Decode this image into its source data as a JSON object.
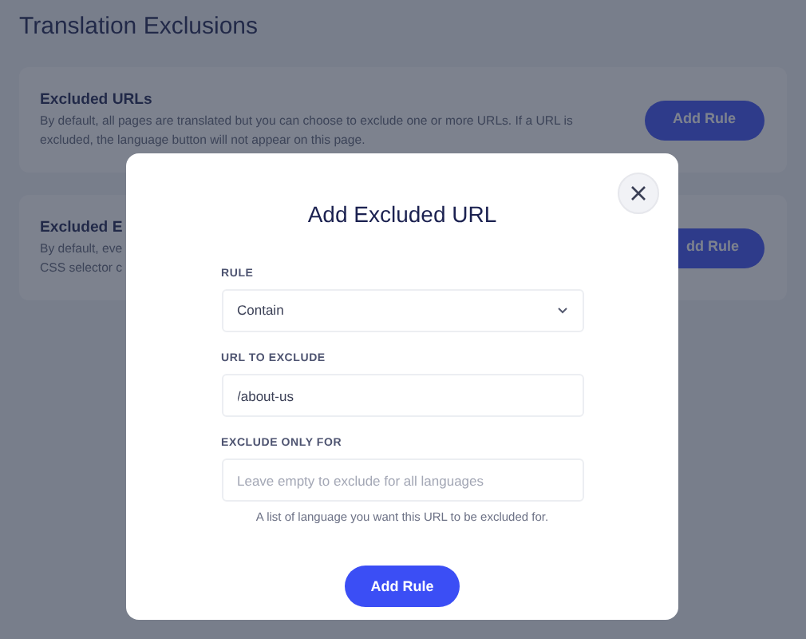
{
  "page_title": "Translation Exclusions",
  "sections": [
    {
      "title": "Excluded URLs",
      "description": "By default, all pages are translated but you can choose to exclude one or more URLs. If a URL is excluded, the language button will not appear on this page.",
      "button": "Add Rule"
    },
    {
      "title": "Excluded E",
      "description_lines": [
        "By default, eve",
        "CSS selector c"
      ],
      "button": "dd Rule"
    }
  ],
  "modal": {
    "title": "Add Excluded URL",
    "fields": [
      {
        "kind": "select",
        "label": "RULE",
        "value": "Contain"
      },
      {
        "kind": "text",
        "label": "URL TO EXCLUDE",
        "value": "/about-us"
      },
      {
        "kind": "text",
        "label": "EXCLUDE ONLY FOR",
        "placeholder": "Leave empty to exclude for all languages",
        "help": "A list of language you want this URL to be excluded for."
      }
    ],
    "submit": "Add Rule"
  }
}
